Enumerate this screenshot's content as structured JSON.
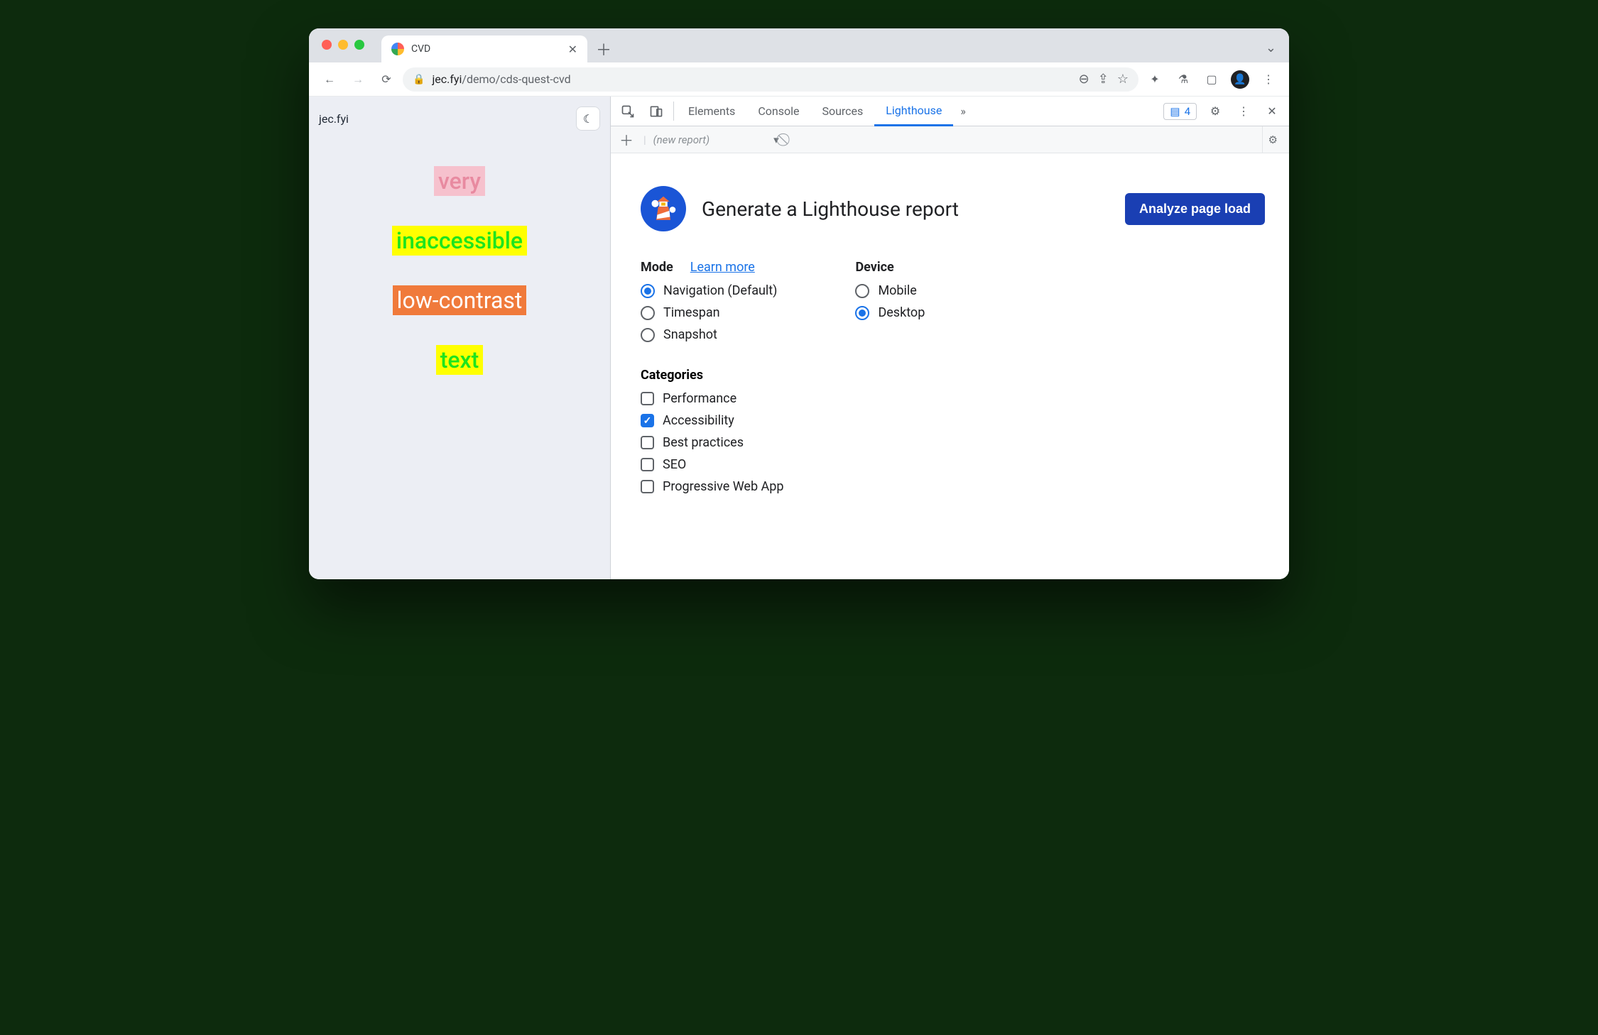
{
  "browser": {
    "tab_title": "CVD",
    "url_host": "jec.fyi",
    "url_path": "/demo/cds-quest-cvd"
  },
  "page": {
    "site_title": "jec.fyi",
    "words": {
      "very": "very",
      "inaccessible": "inaccessible",
      "low_contrast": "low-contrast",
      "text": "text"
    }
  },
  "devtools": {
    "tabs": {
      "elements": "Elements",
      "console": "Console",
      "sources": "Sources",
      "lighthouse": "Lighthouse"
    },
    "issues_count": "4",
    "subbar": {
      "new_report": "(new report)"
    },
    "lighthouse": {
      "title": "Generate a Lighthouse report",
      "analyze_button": "Analyze page load",
      "mode": {
        "heading": "Mode",
        "learn_more": "Learn more",
        "navigation": "Navigation (Default)",
        "timespan": "Timespan",
        "snapshot": "Snapshot",
        "selected": "navigation"
      },
      "device": {
        "heading": "Device",
        "mobile": "Mobile",
        "desktop": "Desktop",
        "selected": "desktop"
      },
      "categories": {
        "heading": "Categories",
        "performance": "Performance",
        "accessibility": "Accessibility",
        "best_practices": "Best practices",
        "seo": "SEO",
        "pwa": "Progressive Web App",
        "checked": [
          "accessibility"
        ]
      }
    }
  }
}
